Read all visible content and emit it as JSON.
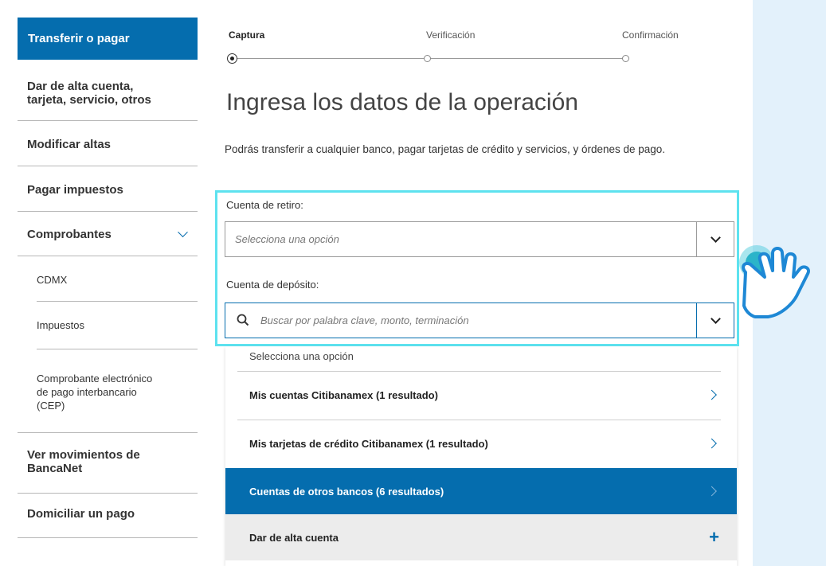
{
  "sidebar": {
    "header": "Transferir o pagar",
    "items": [
      {
        "label": "Dar de alta cuenta,\ntarjeta, servicio, otros"
      },
      {
        "label": "Modificar altas"
      },
      {
        "label": "Pagar impuestos"
      },
      {
        "label": "Comprobantes"
      },
      {
        "label": "CDMX"
      },
      {
        "label": "Impuestos"
      },
      {
        "label": "Comprobante electrónico\nde pago interbancario\n(CEP)"
      },
      {
        "label": "Ver movimientos de\nBancaNet"
      },
      {
        "label": "Domiciliar un pago"
      }
    ]
  },
  "stepper": {
    "steps": [
      "Captura",
      "Verificación",
      "Confirmación"
    ],
    "active_step": "Captura"
  },
  "main": {
    "title": "Ingresa los datos de la operación",
    "intro": "Podrás transferir a cualquier banco, pagar tarjetas de crédito y servicios, y órdenes de pago."
  },
  "form": {
    "withdrawal_label": "Cuenta de retiro:",
    "withdrawal_placeholder": "Selecciona una opción",
    "deposit_label": "Cuenta de depósito:",
    "deposit_placeholder": "Buscar por palabra clave, monto, terminación"
  },
  "dropdown": {
    "hint": "Selecciona una opción",
    "options": [
      {
        "label": "Mis cuentas Citibanamex (1 resultado)"
      },
      {
        "label": "Mis tarjetas de crédito Citibanamex (1 resultado)"
      },
      {
        "label": "Cuentas de otros bancos (6 resultados)"
      }
    ],
    "add_label": "Dar de alta cuenta",
    "selected_index": 2
  },
  "colors": {
    "brand_blue": "#056dae",
    "highlight": "#5de2ef",
    "background": "#e3f1fb"
  },
  "icons": [
    "chevron-down-icon",
    "chevron-right-icon",
    "search-icon",
    "plus-icon",
    "hand-pointer-icon"
  ]
}
